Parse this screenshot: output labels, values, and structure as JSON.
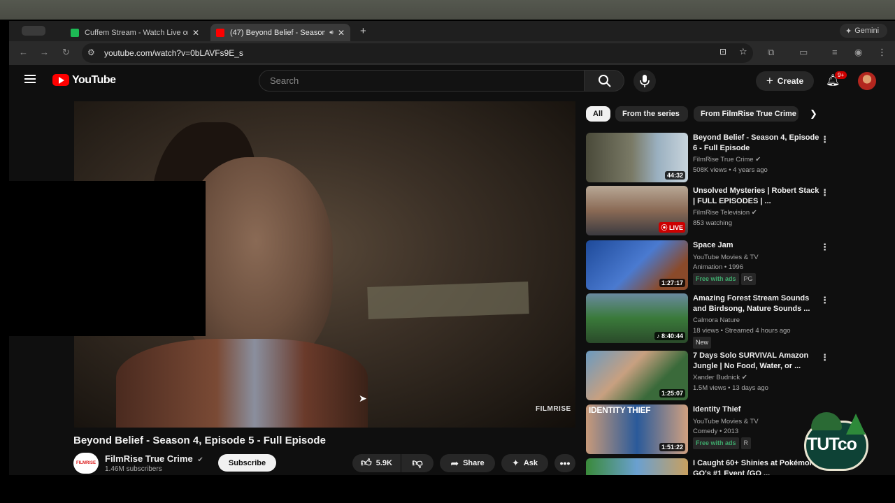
{
  "browser": {
    "tabs": [
      {
        "title": "Cuffem Stream - Watch Live on",
        "favicon_color": "#1db954"
      },
      {
        "title": "(47) Beyond Belief - Season",
        "favicon_color": "#ff0000"
      }
    ],
    "gemini_label": "Gemini",
    "url": "youtube.com/watch?v=0bLAVFs9E_s"
  },
  "masthead": {
    "logo_text": "YouTube",
    "search_placeholder": "Search",
    "create_label": "Create",
    "notif_count": "9+"
  },
  "player": {
    "watermark": "FILMRISE"
  },
  "video": {
    "title": "Beyond Belief - Season 4, Episode 5 - Full Episode",
    "channel": "FilmRise True Crime",
    "channel_avatar_text": "FILMRISE",
    "subscribers": "1.46M subscribers",
    "subscribe_label": "Subscribe",
    "likes": "5.9K",
    "share_label": "Share",
    "ask_label": "Ask"
  },
  "chips": [
    "All",
    "From the series",
    "From FilmRise True Crime"
  ],
  "recommendations": [
    {
      "title": "Beyond Belief - Season 4, Episode 6 - Full Episode",
      "channel": "FilmRise True Crime",
      "meta": "508K views • 4 years ago",
      "duration": "44:32",
      "thumb_color": "#5a5a48"
    },
    {
      "title": "Unsolved Mysteries | Robert Stack | FULL EPISODES | ...",
      "channel": "FilmRise Television",
      "meta": "853 watching",
      "duration": "LIVE",
      "thumb_color": "#6a5040"
    },
    {
      "title": "Space Jam",
      "channel": "YouTube Movies & TV",
      "meta": "Animation • 1996",
      "duration": "1:27:17",
      "tags": [
        "Free with ads",
        "PG"
      ],
      "thumb_color": "#2a5aa0"
    },
    {
      "title": "Amazing Forest Stream Sounds and Birdsong, Nature Sounds ...",
      "channel": "Calmora Nature",
      "meta": "18 views • Streamed 4 hours ago",
      "duration": "8:40:44",
      "tags": [
        "New"
      ],
      "thumb_color": "#3a7a3a"
    },
    {
      "title": "7 Days Solo SURVIVAL Amazon Jungle | No Food, Water, or ...",
      "channel": "Xander Budnick",
      "meta": "1.5M views • 13 days ago",
      "duration": "1:25:07",
      "thumb_color": "#5a7a4a"
    },
    {
      "title": "Identity Thief",
      "channel": "YouTube Movies & TV",
      "meta": "Comedy • 2013",
      "duration": "1:51:22",
      "tags": [
        "Free with ads",
        "R"
      ],
      "thumb_label": "IDENTITY THIEF",
      "thumb_color": "#2a6aa0"
    },
    {
      "title": "I Caught 60+ Shinies at Pokémon GO's #1 Event (GO ...",
      "thumb_color": "#4a8a3a"
    }
  ],
  "overlay": {
    "badge_text": "TUTco"
  }
}
